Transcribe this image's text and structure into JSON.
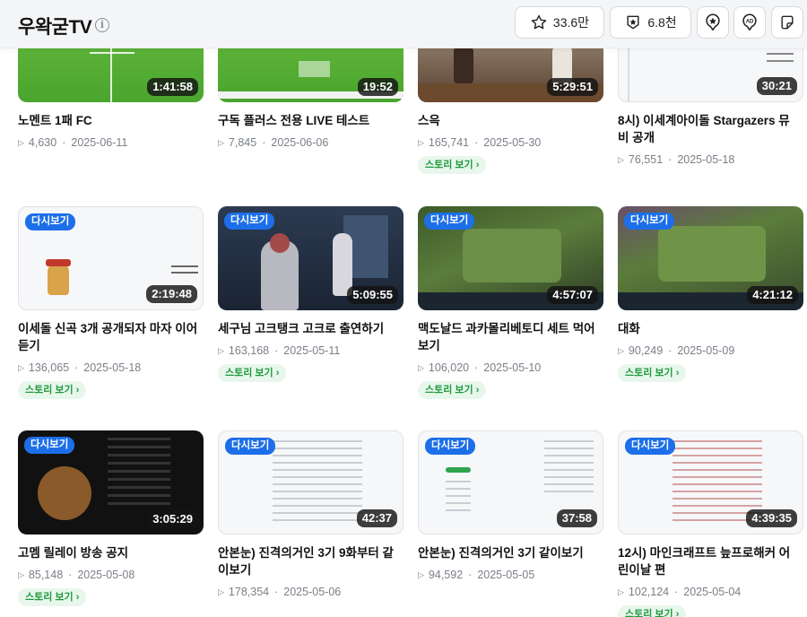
{
  "header": {
    "channel_name": "우왁굳TV",
    "info_label": "i",
    "favorite_count": "33.6만",
    "subscriber_count": "6.8천"
  },
  "videos": [
    {
      "title_lines": [
        "노멘트 1패 FC"
      ],
      "duration": "1:41:58",
      "views": "4,630",
      "date": "2025-06-11",
      "replay": "",
      "story": "",
      "thumb": "soccer"
    },
    {
      "title_lines": [
        "구독 플러스 전용 LIVE 테스트"
      ],
      "duration": "19:52",
      "views": "7,845",
      "date": "2025-06-06",
      "replay": "",
      "story": "",
      "thumb": "soccer"
    },
    {
      "title_lines": [
        "스윽"
      ],
      "duration": "5:29:51",
      "views": "165,741",
      "date": "2025-05-30",
      "replay": "",
      "story": "스토리 보기",
      "thumb": "avatar"
    },
    {
      "title_lines": [
        "8시) 이세계아이돌 Stargazers 뮤",
        "비 공개"
      ],
      "duration": "30:21",
      "views": "76,551",
      "date": "2025-05-18",
      "replay": "",
      "story": "",
      "thumb": "screen"
    },
    {
      "title_lines": [
        "이세돌 신곡 3개 공개되자 마자 이어",
        "듣기"
      ],
      "duration": "2:19:48",
      "views": "136,065",
      "date": "2025-05-18",
      "replay": "다시보기",
      "story": "스토리 보기",
      "thumb": "screen"
    },
    {
      "title_lines": [
        "세구님 고크탱크 고크로 출연하기"
      ],
      "duration": "5:09:55",
      "views": "163,168",
      "date": "2025-05-11",
      "replay": "다시보기",
      "story": "스토리 보기",
      "thumb": "city"
    },
    {
      "title_lines": [
        "맥도날드 과카몰리베토디 세트 먹어",
        "보기"
      ],
      "duration": "4:57:07",
      "views": "106,020",
      "date": "2025-05-10",
      "replay": "다시보기",
      "story": "스토리 보기",
      "thumb": "tft"
    },
    {
      "title_lines": [
        "대화"
      ],
      "duration": "4:21:12",
      "views": "90,249",
      "date": "2025-05-09",
      "replay": "다시보기",
      "story": "스토리 보기",
      "thumb": "tft"
    },
    {
      "title_lines": [
        "고멤 릴레이 방송 공지"
      ],
      "duration": "3:05:29",
      "views": "85,148",
      "date": "2025-05-08",
      "replay": "다시보기",
      "story": "스토리 보기",
      "thumb": "dark"
    },
    {
      "title_lines": [
        "안본눈) 진격의거인 3기 9화부터 같",
        "이보기"
      ],
      "duration": "42:37",
      "views": "178,354",
      "date": "2025-05-06",
      "replay": "다시보기",
      "story": "",
      "thumb": "screen"
    },
    {
      "title_lines": [
        "안본눈) 진격의거인 3기 같이보기"
      ],
      "duration": "37:58",
      "views": "94,592",
      "date": "2025-05-05",
      "replay": "다시보기",
      "story": "",
      "thumb": "screen"
    },
    {
      "title_lines": [
        "12시) 마인크래프트 늪프로해커 어",
        "린이날 편"
      ],
      "duration": "4:39:35",
      "views": "102,124",
      "date": "2025-05-04",
      "replay": "다시보기",
      "story": "스토리 보기",
      "thumb": "screen"
    }
  ],
  "icons": {
    "favorite": "star-icon",
    "subscribe": "star-badge-icon",
    "pin": "star-pin-icon",
    "ad": "ad-icon",
    "sticker": "sticker-icon",
    "play": "play-icon"
  },
  "colors": {
    "replay_badge": "#1c6fe8",
    "story_bg": "#e8f7ec",
    "story_text": "#1f9a3e"
  }
}
